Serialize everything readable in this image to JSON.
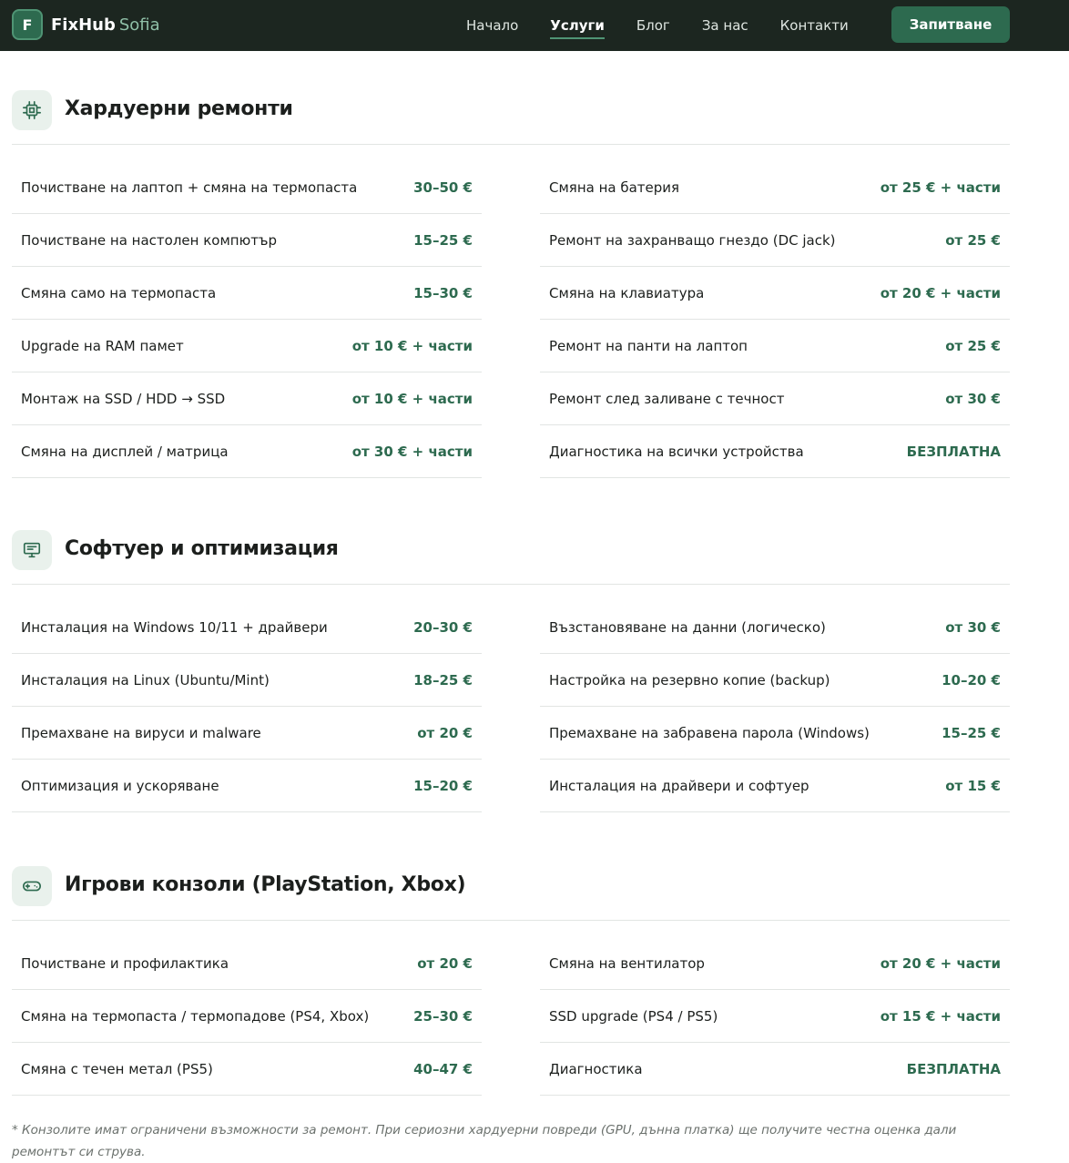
{
  "brand": {
    "badge": "F",
    "name": "FixHub",
    "city": "Sofia"
  },
  "nav": [
    {
      "label": "Начало",
      "active": false
    },
    {
      "label": "Услуги",
      "active": true
    },
    {
      "label": "Блог",
      "active": false
    },
    {
      "label": "За нас",
      "active": false
    },
    {
      "label": "Контакти",
      "active": false
    }
  ],
  "cta_label": "Запитване",
  "colors": {
    "navbar": "#1c2620",
    "accent": "#2d6a4f",
    "icon_bg": "#e9f1ec"
  },
  "sections": [
    {
      "icon": "cpu-icon",
      "title": "Хардуерни ремонти",
      "left": [
        {
          "name": "Почистване на лаптоп + смяна на термопаста",
          "price": "30–50 €"
        },
        {
          "name": "Почистване на настолен компютър",
          "price": "15–25 €"
        },
        {
          "name": "Смяна само на термопаста",
          "price": "15–30 €"
        },
        {
          "name": "Upgrade на RAM памет",
          "price": "от 10 € + части"
        },
        {
          "name": "Монтаж на SSD / HDD → SSD",
          "price": "от 10 € + части"
        },
        {
          "name": "Смяна на дисплей / матрица",
          "price": "от 30 € + части"
        }
      ],
      "right": [
        {
          "name": "Смяна на батерия",
          "price": "от 25 € + части"
        },
        {
          "name": "Ремонт на захранващо гнездо (DC jack)",
          "price": "от 25 €"
        },
        {
          "name": "Смяна на клавиатура",
          "price": "от 20 € + части"
        },
        {
          "name": "Ремонт на панти на лаптоп",
          "price": "от 25 €"
        },
        {
          "name": "Ремонт след заливане с течност",
          "price": "от 30 €"
        },
        {
          "name": "Диагностика на всички устройства",
          "price": "БЕЗПЛАТНА"
        }
      ]
    },
    {
      "icon": "monitor-icon",
      "title": "Софтуер и оптимизация",
      "left": [
        {
          "name": "Инсталация на Windows 10/11 + драйвери",
          "price": "20–30 €"
        },
        {
          "name": "Инсталация на Linux (Ubuntu/Mint)",
          "price": "18–25 €"
        },
        {
          "name": "Премахване на вируси и malware",
          "price": "от 20 €"
        },
        {
          "name": "Оптимизация и ускоряване",
          "price": "15–20 €"
        }
      ],
      "right": [
        {
          "name": "Възстановяване на данни (логическо)",
          "price": "от 30 €"
        },
        {
          "name": "Настройка на резервно копие (backup)",
          "price": "10–20 €"
        },
        {
          "name": "Премахване на забравена парола (Windows)",
          "price": "15–25 €"
        },
        {
          "name": "Инсталация на драйвери и софтуер",
          "price": "от 15 €"
        }
      ]
    },
    {
      "icon": "gamepad-icon",
      "title": "Игрови конзоли (PlayStation, Xbox)",
      "left": [
        {
          "name": "Почистване и профилактика",
          "price": "от 20 €"
        },
        {
          "name": "Смяна на термопаста / термопадове (PS4, Xbox)",
          "price": "25–30 €"
        },
        {
          "name": "Смяна с течен метал (PS5)",
          "price": "40–47 €"
        }
      ],
      "right": [
        {
          "name": "Смяна на вентилатор",
          "price": "от 20 € + части"
        },
        {
          "name": "SSD upgrade (PS4 / PS5)",
          "price": "от 15 € + части"
        },
        {
          "name": "Диагностика",
          "price": "БЕЗПЛАТНА"
        }
      ]
    }
  ],
  "footnote": "* Конзолите имат ограничени възможности за ремонт. При сериозни хардуерни повреди (GPU, дънна платка) ще получите честна оценка дали ремонтът си струва."
}
